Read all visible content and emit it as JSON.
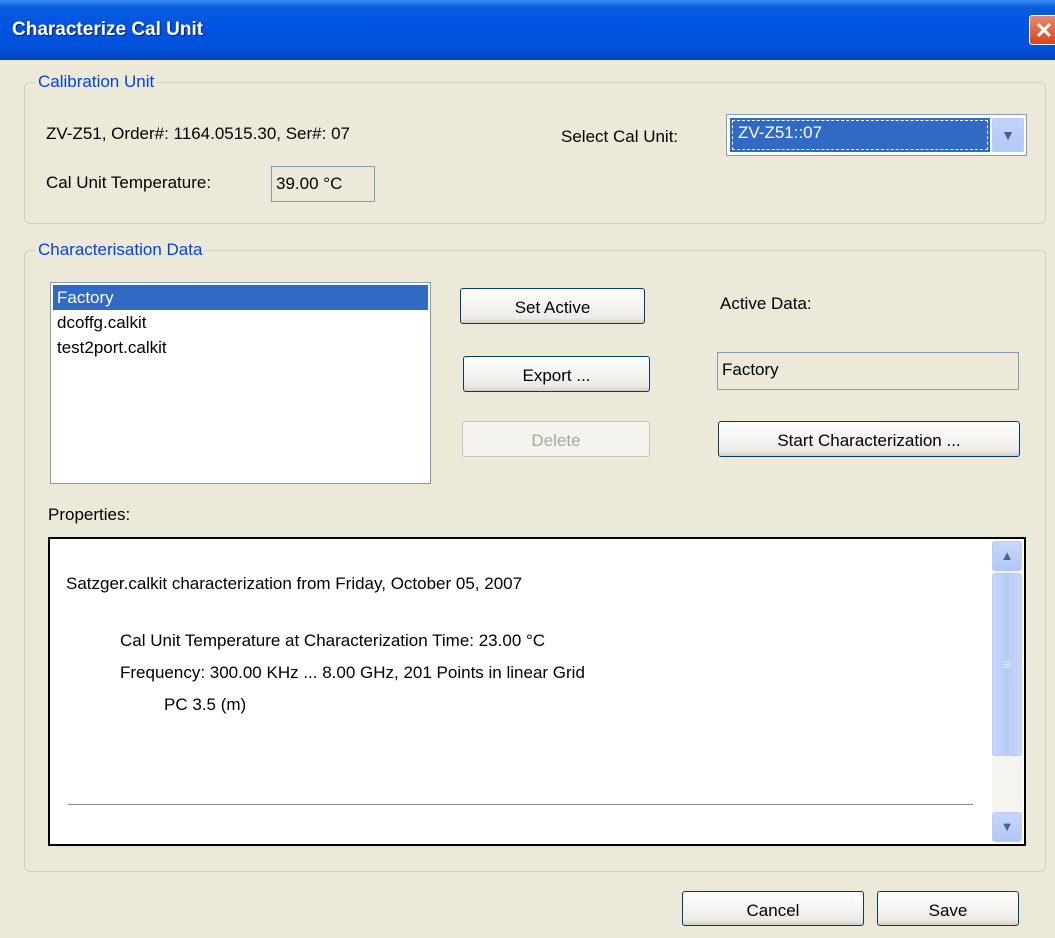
{
  "window": {
    "title": "Characterize Cal Unit",
    "close_glyph": "✕"
  },
  "calibration_unit": {
    "legend": "Calibration Unit",
    "info": "ZV-Z51, Order#: 1164.0515.30, Ser#: 07",
    "select_label": "Select Cal Unit:",
    "select_value": "ZV-Z51::07",
    "temperature_label": "Cal Unit Temperature:",
    "temperature_value": "39.00 °C"
  },
  "characterisation": {
    "legend": "Characterisation Data",
    "items": [
      {
        "label": "Factory",
        "selected": true
      },
      {
        "label": "dcoffg.calkit",
        "selected": false
      },
      {
        "label": "test2port.calkit",
        "selected": false
      }
    ],
    "set_active_label": "Set Active",
    "export_label": "Export ...",
    "delete_label": "Delete",
    "active_data_label": "Active Data:",
    "active_data_value": "Factory",
    "start_label": "Start Characterization ..."
  },
  "properties": {
    "label": "Properties:",
    "title": "Satzger.calkit characterization from Friday, October 05, 2007",
    "temperature_line": "Cal Unit Temperature at Characterization Time: 23.00 °C",
    "frequency_line": "Frequency: 300.00 KHz ... 8.00 GHz, 201 Points in linear Grid",
    "connector_line": "PC 3.5 (m)"
  },
  "footer": {
    "cancel_label": "Cancel",
    "save_label": "Save"
  },
  "icons": {
    "dropdown": "chevron-down-icon",
    "scroll_up": "chevron-up-icon",
    "scroll_down": "chevron-down-icon",
    "grip": "grip-icon"
  }
}
